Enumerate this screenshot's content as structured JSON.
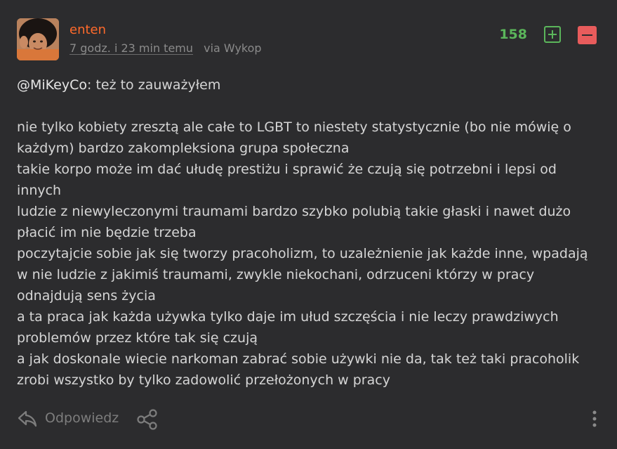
{
  "author": {
    "username": "enten",
    "time": "7 godz. i 23 min temu",
    "via": "via Wykop"
  },
  "votes": {
    "score": "158",
    "plus_icon": "plus-square-icon",
    "minus_icon": "minus-square-icon"
  },
  "body": {
    "mention": "@MiKeyCo",
    "mention_rest": ": też to zauważyłem",
    "paragraphs": [
      "nie tylko kobiety zresztą ale całe to LGBT to niestety statystycznie (bo nie mówię o każdym) bardzo zakompleksiona grupa społeczna",
      "takie korpo może im dać ułudę prestiżu i sprawić że czują się potrzebni i lepsi od innych",
      "ludzie z niewyleczonymi traumami bardzo szybko polubią takie głaski i nawet dużo płacić im nie będzie trzeba",
      "poczytajcie sobie jak się tworzy pracoholizm, to uzależnienie jak każde inne, wpadają w nie ludzie z jakimiś traumami, zwykle niekochani, odrzuceni którzy w pracy odnajdują sens życia",
      "a ta praca jak każda używka tylko daje im ułud szczęścia i nie leczy prawdziwych problemów przez które tak się czują",
      "a jak doskonale wiecie narkoman zabrać sobie używki nie da, tak też taki pracoholik zrobi wszystko by tylko zadowolić przełożonych w pracy"
    ]
  },
  "actions": {
    "reply_label": "Odpowiedz",
    "reply_icon": "reply-arrow-icon",
    "share_icon": "share-icon",
    "more_icon": "more-vertical-icon"
  },
  "colors": {
    "username": "#ff6a2b",
    "score": "#5bb65b",
    "minus": "#e85c5c",
    "background": "#2c2c2e"
  }
}
